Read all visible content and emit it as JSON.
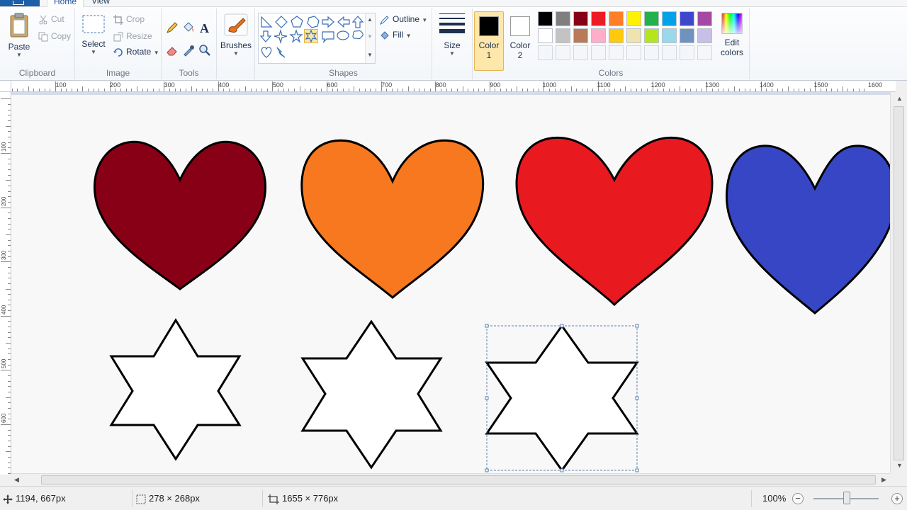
{
  "tabs": {
    "home": "Home",
    "view": "View"
  },
  "clipboard": {
    "paste": "Paste",
    "cut": "Cut",
    "copy": "Copy",
    "label": "Clipboard"
  },
  "image": {
    "select": "Select",
    "crop": "Crop",
    "resize": "Resize",
    "rotate": "Rotate",
    "label": "Image"
  },
  "tools": {
    "label": "Tools"
  },
  "brushes": {
    "label": "Brushes"
  },
  "shapes": {
    "outline": "Outline",
    "fill": "Fill",
    "label": "Shapes"
  },
  "size": {
    "label": "Size"
  },
  "colors": {
    "color1": "Color",
    "color1_num": "1",
    "color2": "Color",
    "color2_num": "2",
    "edit": "Edit",
    "edit2": "colors",
    "label": "Colors",
    "color1_value": "#000000",
    "color2_value": "#ffffff",
    "palette_row1": [
      "#000000",
      "#7f7f7f",
      "#880015",
      "#ed1c24",
      "#ff7f27",
      "#fff200",
      "#22b14c",
      "#00a2e8",
      "#3f48cc",
      "#a349a4"
    ],
    "palette_row2": [
      "#ffffff",
      "#c3c3c3",
      "#b97a57",
      "#ffaec9",
      "#ffc90e",
      "#efe4b0",
      "#b5e61d",
      "#99d9ea",
      "#7092be",
      "#c8bfe7"
    ]
  },
  "ruler_h": [
    "100",
    "200",
    "300",
    "400",
    "500",
    "600",
    "700",
    "800",
    "900",
    "1000",
    "1100",
    "1200",
    "1300",
    "1400",
    "1500",
    "1600"
  ],
  "ruler_v": [
    "100",
    "200",
    "300",
    "400",
    "500",
    "600"
  ],
  "canvas_shapes": {
    "hearts": [
      "#880015",
      "#f7781f",
      "#e8191f",
      "#3646c4"
    ],
    "star_fill": "#ffffff",
    "stroke": "#000000"
  },
  "status": {
    "cursor": "1194, 667px",
    "selection": "278 × 268px",
    "canvas_size": "1655 × 776px",
    "zoom": "100%"
  }
}
